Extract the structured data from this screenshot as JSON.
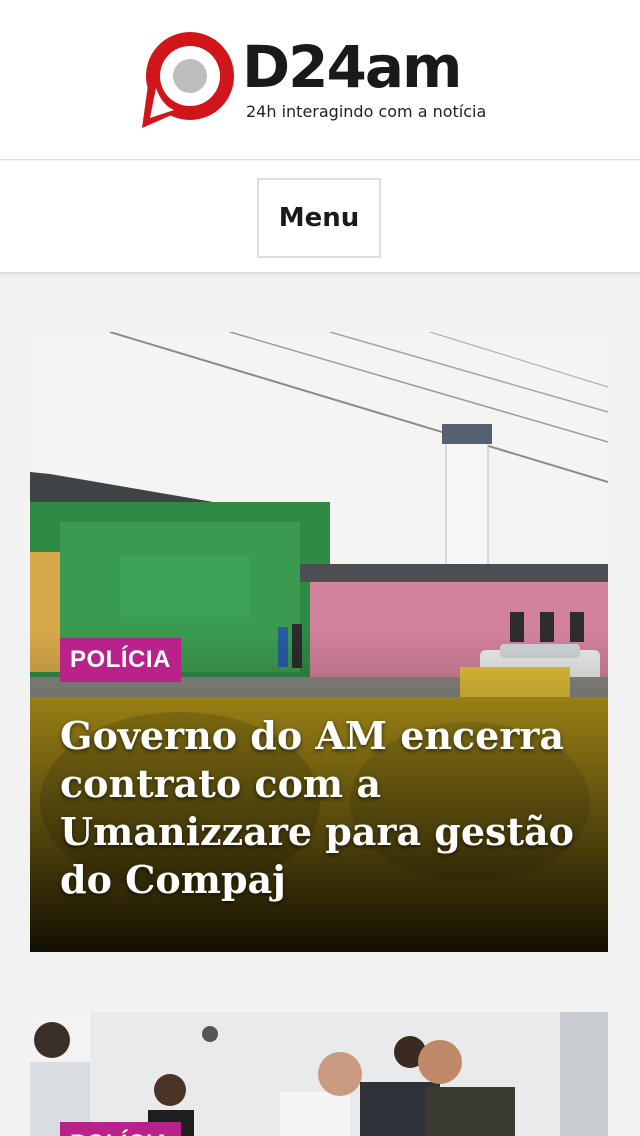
{
  "header": {
    "logo_name": "D24am",
    "tagline": "24h interagindo com a notícia",
    "brand_color": "#d0161b"
  },
  "nav": {
    "menu_label": "Menu"
  },
  "articles": [
    {
      "category": "POLÍCIA",
      "title": "Governo do AM encerra contrato com a Umanizzare para gestão do Compaj",
      "category_color": "#b8228a"
    },
    {
      "category": "POLÍCIA",
      "category_color": "#b8228a"
    }
  ]
}
